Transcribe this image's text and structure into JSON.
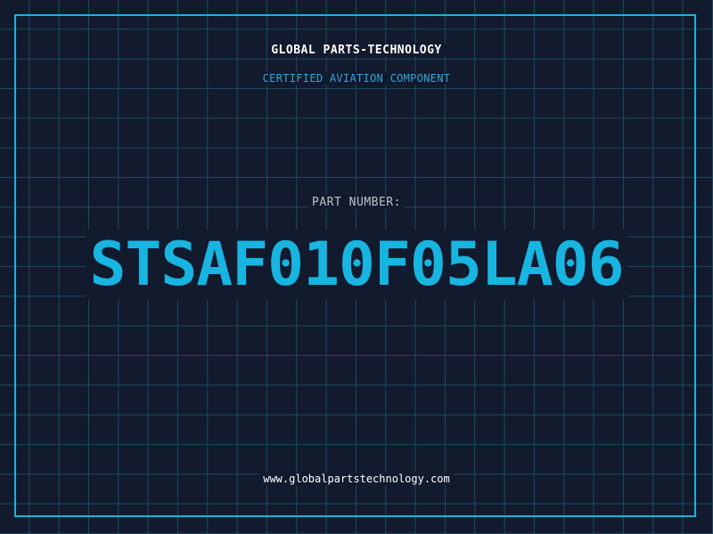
{
  "header": {
    "company": "GLOBAL PARTS-TECHNOLOGY",
    "subtitle": "CERTIFIED AVIATION COMPONENT"
  },
  "part": {
    "label": "PART NUMBER:",
    "number": "STSAF010F05LA06"
  },
  "footer": {
    "website": "www.globalpartstechnology.com"
  },
  "colors": {
    "background": "#121a2e",
    "grid": "#1f4a5e",
    "accent": "#17b5e0",
    "border": "#1fb0d8"
  }
}
